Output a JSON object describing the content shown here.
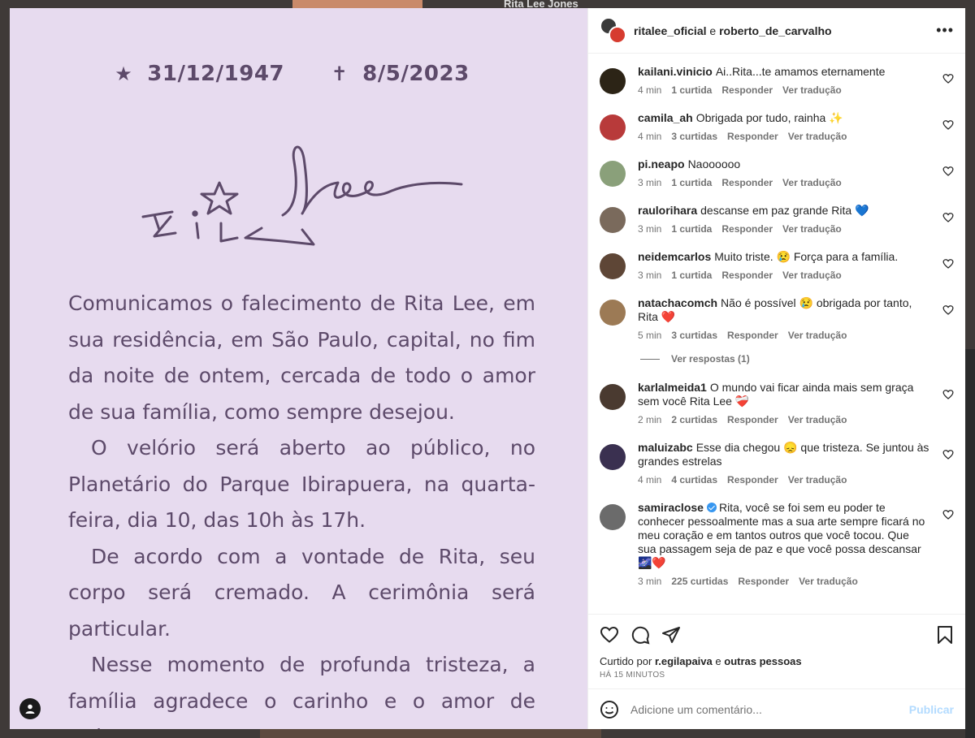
{
  "backdrop": {
    "top_text": "Rita Lee Jones"
  },
  "post_image": {
    "birth_symbol": "★",
    "birth_date": "31/12/1947",
    "death_symbol": "✝",
    "death_date": "8/5/2023",
    "paragraphs": [
      "Comunicamos o falecimento de Rita Lee, em sua residência, em São Paulo, capital, no fim da noite de ontem, cercada de todo o amor de sua família, como sempre desejou.",
      "O velório será aberto ao público, no Planetário do Parque Ibirapuera, na quarta-feira, dia 10, das 10h às 17h.",
      "De acordo com a vontade de Rita, seu corpo será cremado. A cerimônia será particular.",
      "Nesse momento de profunda tristeza, a família agradece o carinho e o amor de todos."
    ],
    "signature": "Rita Lee"
  },
  "header": {
    "user1": "ritalee_oficial",
    "connector": "e",
    "user2": "roberto_de_carvalho",
    "more_icon": "more-horizontal-icon"
  },
  "comments": [
    {
      "user": "kailani.vinicio",
      "text": "Ai..Rita...te amamos eternamente",
      "time": "4 min",
      "likes": "1 curtida",
      "reply": "Responder",
      "translate": "Ver tradução",
      "avatar_color": "#2c2416"
    },
    {
      "user": "camila_ah",
      "text": "Obrigada por tudo, rainha ✨",
      "time": "4 min",
      "likes": "3 curtidas",
      "reply": "Responder",
      "translate": "Ver tradução",
      "avatar_color": "#b83a3a"
    },
    {
      "user": "pi.neapo",
      "text": "Naoooooo",
      "time": "3 min",
      "likes": "1 curtida",
      "reply": "Responder",
      "translate": "Ver tradução",
      "avatar_color": "#8aa07a"
    },
    {
      "user": "raulorihara",
      "text": "descanse em paz grande Rita 💙",
      "time": "3 min",
      "likes": "1 curtida",
      "reply": "Responder",
      "translate": "Ver tradução",
      "avatar_color": "#7a6a5c"
    },
    {
      "user": "neidemcarlos",
      "text": "Muito triste. 😢 Força para a família.",
      "time": "3 min",
      "likes": "1 curtida",
      "reply": "Responder",
      "translate": "Ver tradução",
      "avatar_color": "#5e4636"
    },
    {
      "user": "natachacomch",
      "text": "Não é possível 😢 obrigada por tanto, Rita ❤️",
      "time": "5 min",
      "likes": "3 curtidas",
      "reply": "Responder",
      "translate": "Ver tradução",
      "avatar_color": "#9c7a55"
    }
  ],
  "view_replies": "Ver respostas (1)",
  "comments_after": [
    {
      "user": "karlalmeida1",
      "text": "O mundo vai ficar ainda mais sem graça sem você Rita Lee ❤️‍🩹",
      "time": "2 min",
      "likes": "2 curtidas",
      "reply": "Responder",
      "translate": "Ver tradução",
      "avatar_color": "#4a3a30"
    },
    {
      "user": "maluizabc",
      "text": "Esse dia chegou 😞 que tristeza. Se juntou às grandes estrelas",
      "time": "4 min",
      "likes": "4 curtidas",
      "reply": "Responder",
      "translate": "Ver tradução",
      "avatar_color": "#3a3050"
    },
    {
      "user": "samiraclose",
      "text": "Rita, você se foi sem eu poder te conhecer pessoalmente mas a sua arte sempre ficará no meu coração e em tantos outros que você tocou. Que sua passagem seja de paz e que você possa descansar 🌌❤️",
      "time": "3 min",
      "likes": "225 curtidas",
      "reply": "Responder",
      "translate": "Ver tradução",
      "avatar_color": "#6b6b6b",
      "verified": true
    }
  ],
  "actions": {
    "like_icon": "heart-icon",
    "comment_icon": "comment-icon",
    "share_icon": "send-icon",
    "save_icon": "bookmark-icon",
    "liked_by_prefix": "Curtido por",
    "liked_by_user": "r.egilapaiva",
    "liked_by_connector": "e",
    "liked_by_others": "outras pessoas",
    "time_ago": "HÁ 15 MINUTOS"
  },
  "composer": {
    "emoji_icon": "emoji-icon",
    "placeholder": "Adicione um comentário...",
    "publish": "Publicar"
  },
  "colors": {
    "image_bg": "#e7dbef",
    "image_text": "#5d4a6a",
    "publish_disabled": "#b3dbff",
    "verified": "#3797f0"
  }
}
